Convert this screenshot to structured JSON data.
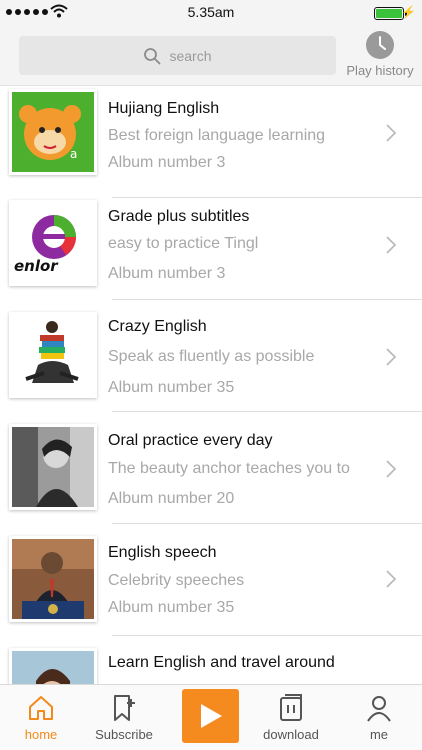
{
  "status_bar": {
    "time": "5.35am",
    "battery_color": "#3ac33a"
  },
  "header": {
    "search_placeholder": "search",
    "play_history_label": "Play history"
  },
  "albums": [
    {
      "title": "Hujiang English",
      "description": "Best foreign language learning",
      "count": "Album number 3",
      "thumb_icon": "cartoon-monkey-image"
    },
    {
      "title": "Grade plus subtitles",
      "description": "easy to practice Tingl",
      "count": "Album number 3",
      "thumb_icon": "enlore-logo-image"
    },
    {
      "title": "Crazy English",
      "description": "Speak as fluently as possible",
      "count": "Album number 35",
      "thumb_icon": "girl-with-books-image"
    },
    {
      "title": "Oral practice every day",
      "description": "The beauty anchor teaches you to",
      "count": "Album number 20",
      "thumb_icon": "portrait-photo-image"
    },
    {
      "title": "English speech",
      "description": "Celebrity speeches",
      "count": "Album number 35",
      "thumb_icon": "speaker-podium-image"
    },
    {
      "title": "Learn English and travel around",
      "description": "",
      "count": "",
      "thumb_icon": "woman-photo-image"
    }
  ],
  "tabbar": {
    "home": "home",
    "subscribe": "Subscribe",
    "download": "download",
    "me": "me"
  },
  "colors": {
    "accent": "#f58a1f",
    "active_tab": "#f48a1a"
  }
}
